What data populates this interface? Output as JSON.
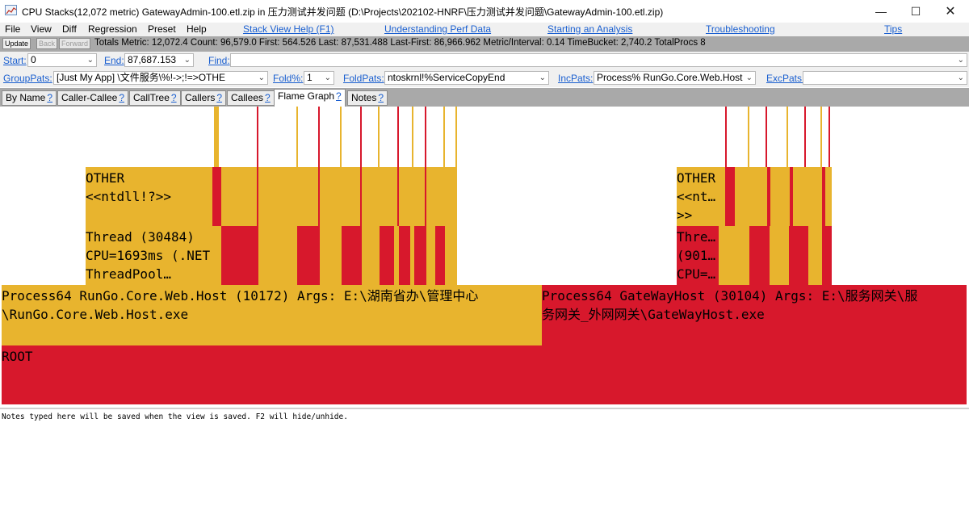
{
  "window": {
    "title": "CPU Stacks(12,072 metric) GatewayAdmin-100.etl.zip in 压力测试并发问题 (D:\\Projects\\202102-HNRF\\压力测试并发问题\\GatewayAdmin-100.etl.zip)",
    "minimize": "—",
    "maximize": "☐",
    "close": "✕"
  },
  "menu": {
    "items": [
      "File",
      "View",
      "Diff",
      "Regression",
      "Preset",
      "Help"
    ],
    "links": [
      "Stack View Help (F1)",
      "Understanding Perf Data",
      "Starting an Analysis",
      "Troubleshooting",
      "Tips"
    ]
  },
  "totals": {
    "update": "Update",
    "back": "Back",
    "forward": "Forward",
    "text": "Totals Metric: 12,072.4  Count: 96,579.0  First: 564.526 Last: 87,531.488  Last-First: 86,966.962  Metric/Interval: 0.14  TimeBucket: 2,740.2  TotalProcs 8"
  },
  "filters": {
    "start_label": "Start:",
    "start_value": "0",
    "end_label": "End:",
    "end_value": "87,687.153",
    "find_label": "Find:",
    "find_value": "",
    "grouppats_label": "GroupPats:",
    "grouppats_value": "[Just My App]         \\文件服务\\%!->;!=>OTHE",
    "fold_label": "Fold%:",
    "fold_value": "1",
    "foldpats_label": "FoldPats:",
    "foldpats_value": "ntoskrnl!%ServiceCopyEnd",
    "incpats_label": "IncPats:",
    "incpats_value": "Process% RunGo.Core.Web.Host",
    "excpats_label": "ExcPats:",
    "excpats_value": ""
  },
  "tabs": [
    {
      "label": "By Name",
      "q": "?"
    },
    {
      "label": "Caller-Callee",
      "q": "?"
    },
    {
      "label": "CallTree",
      "q": "?"
    },
    {
      "label": "Callers",
      "q": "?"
    },
    {
      "label": "Callees",
      "q": "?"
    },
    {
      "label": "Flame Graph",
      "q": "?"
    },
    {
      "label": "Notes",
      "q": "?"
    }
  ],
  "active_tab": "Flame Graph",
  "colors": {
    "yellow": "#e8b42e",
    "red": "#d7182c"
  },
  "flame": {
    "root": "ROOT",
    "process1": "Process64 RunGo.Core.Web.Host (10172) Args: E:\\湖南省办\\管理中心\n\\RunGo.Core.Web.Host.exe",
    "process2": "Process64 GateWayHost (30104) Args: E:\\服务网关\\服\n务网关_外网网关\\GateWayHost.exe",
    "thread1": "Thread (30484)\nCPU=1693ms (.NET\nThreadPool…",
    "thread2": "Thre…\n(901…\nCPU=…",
    "other1": "OTHER\n<<ntdll!?>>",
    "other2": "OTHER\n<<nt…\n>>"
  },
  "notes": {
    "text": "Notes typed here will be saved when the view is saved. F2 will hide/unhide."
  }
}
